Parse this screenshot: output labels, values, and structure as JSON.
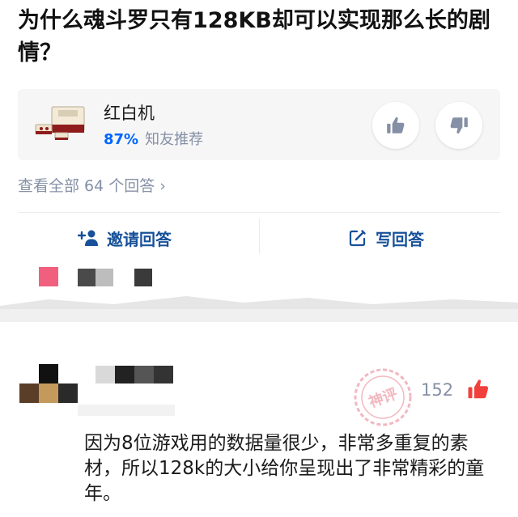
{
  "question": {
    "title": "为什么魂斗罗只有128KB却可以实现那么长的剧情？"
  },
  "topic_card": {
    "name": "红白机",
    "recommend_percent": "87%",
    "recommend_text": "知友推荐",
    "thumb_icon": "famicom-console-image"
  },
  "view_all": {
    "text": "查看全部 64 个回答",
    "chevron": "›"
  },
  "actions": {
    "invite_label": "邀请回答",
    "write_label": "写回答"
  },
  "answer": {
    "vote_count": "152",
    "stamp_text": "神评",
    "content": "因为8位游戏用的数据量很少，非常多重复的素材，所以128k的大小给你呈现出了非常精彩的童年。"
  },
  "colors": {
    "accent_blue": "#0066ff",
    "action_blue": "#175199",
    "muted": "#8590a6",
    "vote_red": "#f1403c"
  }
}
